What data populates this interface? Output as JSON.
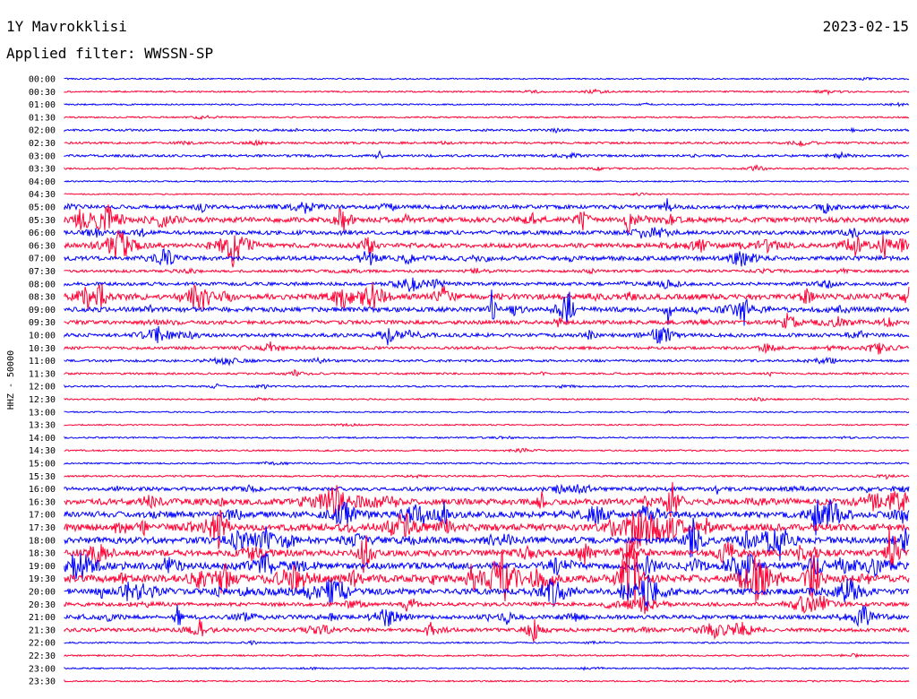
{
  "header": {
    "station": "1Y Mavrokklisi",
    "date": "2023-02-15",
    "filter": "Applied filter: WWSSN-SP"
  },
  "chart_data": {
    "type": "line",
    "title": "1Y Mavrokklisi",
    "subtitle": "Applied filter: WWSSN-SP",
    "date": "2023-02-15",
    "ylabel": "HHZ - 50000",
    "xlabel": "",
    "trace_labels": [
      "00:00",
      "00:30",
      "01:00",
      "01:30",
      "02:00",
      "02:30",
      "03:00",
      "03:30",
      "04:00",
      "04:30",
      "05:00",
      "05:30",
      "06:00",
      "06:30",
      "07:00",
      "07:30",
      "08:00",
      "08:30",
      "09:00",
      "09:30",
      "10:00",
      "10:30",
      "11:00",
      "11:30",
      "12:00",
      "12:30",
      "13:00",
      "13:30",
      "14:00",
      "14:30",
      "15:00",
      "15:30",
      "16:00",
      "16:30",
      "17:00",
      "17:30",
      "18:00",
      "18:30",
      "19:00",
      "19:30",
      "20:00",
      "20:30",
      "21:00",
      "21:30",
      "22:00",
      "22:30",
      "23:00",
      "23:30"
    ],
    "trace_activity": [
      0.03,
      0.05,
      0.04,
      0.05,
      0.12,
      0.12,
      0.14,
      0.06,
      0.02,
      0.02,
      0.3,
      0.45,
      0.32,
      0.38,
      0.35,
      0.18,
      0.25,
      0.48,
      0.4,
      0.3,
      0.28,
      0.2,
      0.15,
      0.1,
      0.06,
      0.04,
      0.03,
      0.03,
      0.05,
      0.05,
      0.06,
      0.07,
      0.3,
      0.55,
      0.55,
      0.65,
      0.6,
      0.55,
      0.58,
      0.7,
      0.55,
      0.3,
      0.32,
      0.3,
      0.05,
      0.05,
      0.04,
      0.04
    ],
    "colors": [
      "#0000ff",
      "#ff0033"
    ],
    "grid": false,
    "legend": "none"
  }
}
